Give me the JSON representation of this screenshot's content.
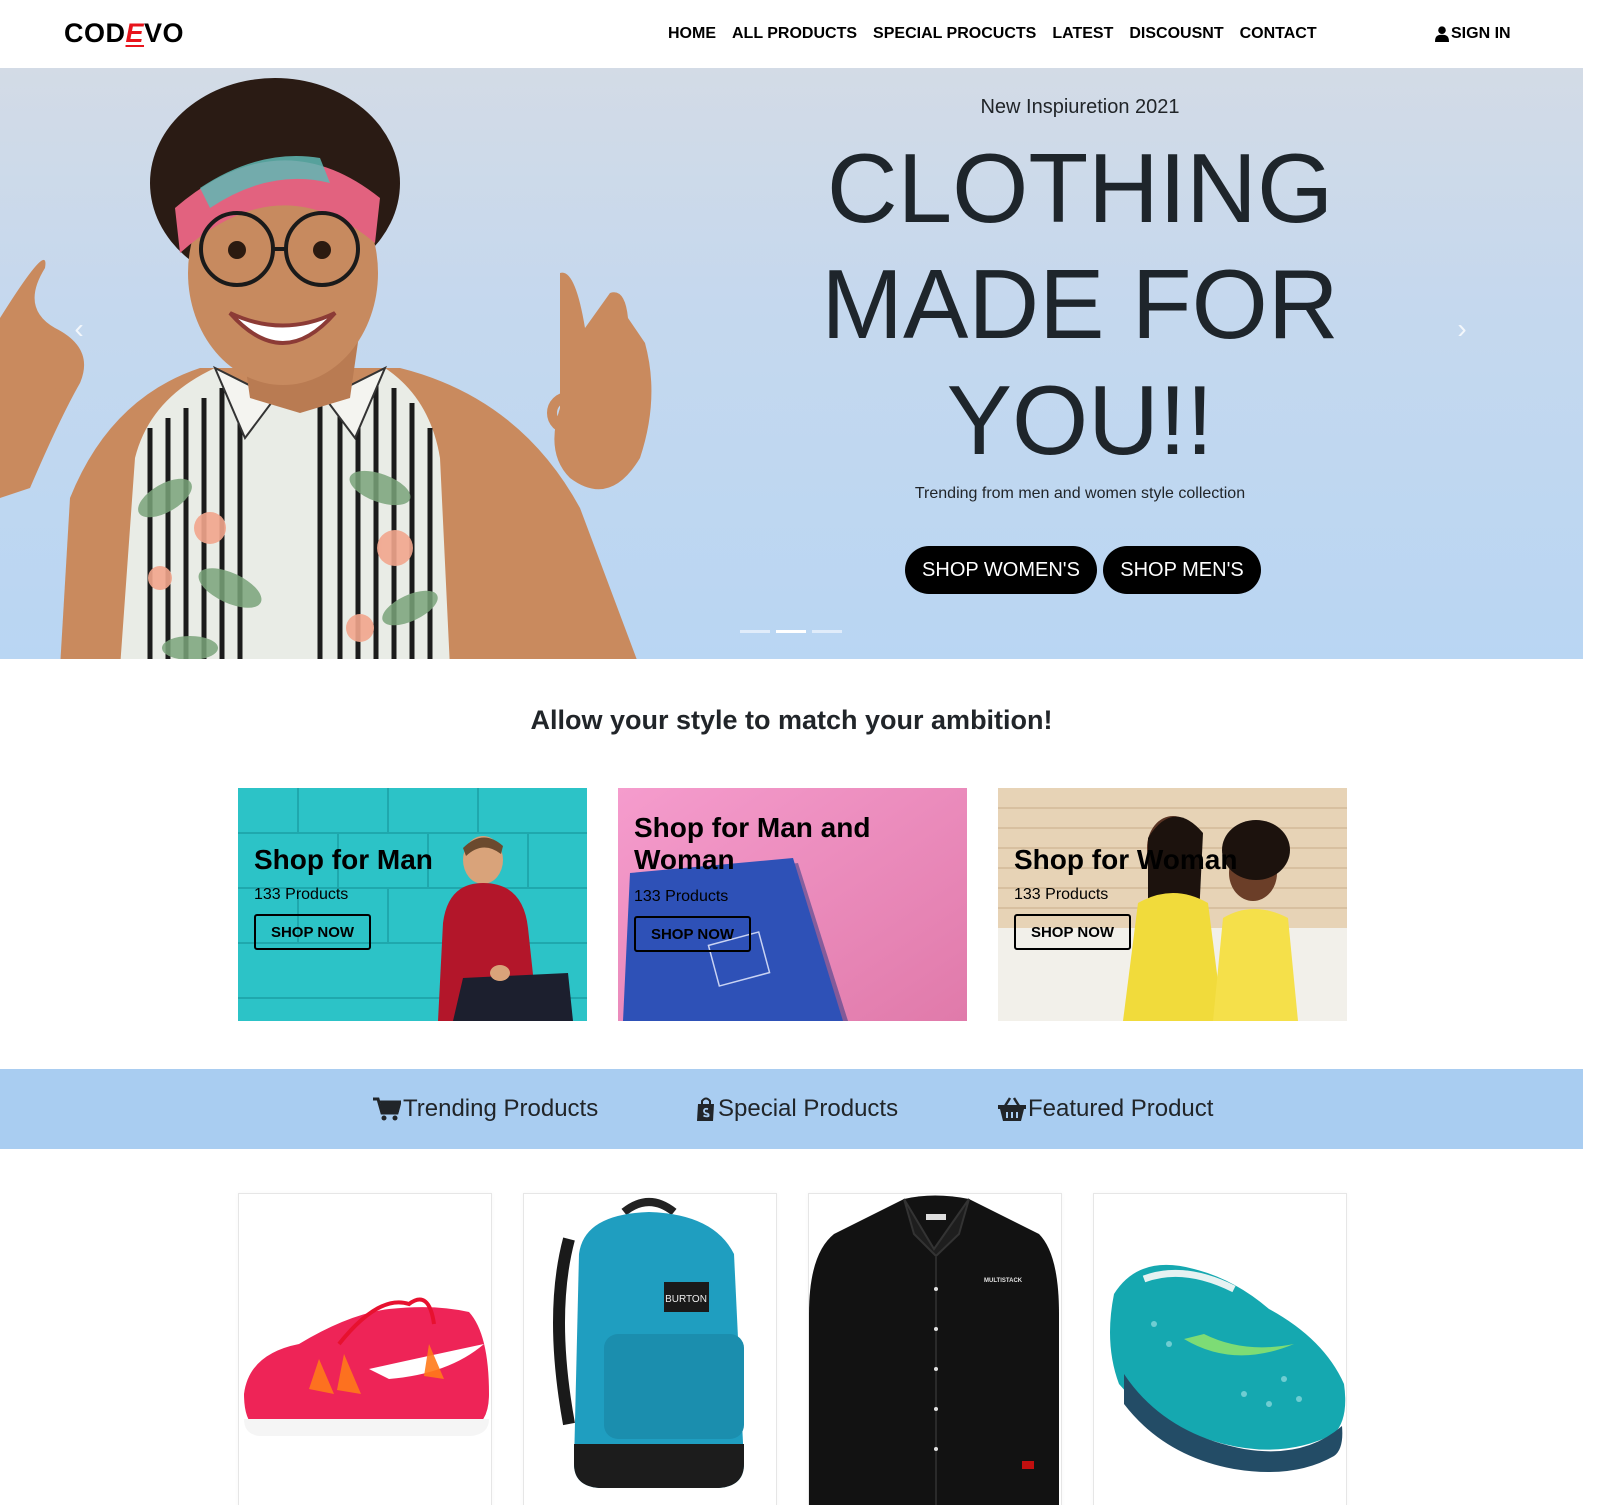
{
  "brand": {
    "prefix": "COD",
    "accent": "E",
    "suffix": "VO",
    "accent_color": "#e8141c"
  },
  "nav": {
    "items": [
      "HOME",
      "ALL PRODUCTS",
      "SPECIAL PROCUCTS",
      "LATEST",
      "DISCOUSNT",
      "CONTACT"
    ],
    "sign_in": "SIGN IN"
  },
  "hero": {
    "kicker": "New Inspiuretion 2021",
    "title": "CLOTHING MADE FOR YOU!!",
    "subtitle": "Trending from men and women style collection",
    "shop_womens": "SHOP WOMEN'S",
    "shop_mens": "SHOP MEN'S",
    "prev_icon": "chevron-left-icon",
    "next_icon": "chevron-right-icon",
    "slide_count": 3,
    "active_slide": 2
  },
  "tagline": "Allow your style to match your ambition!",
  "categories": [
    {
      "title": "Shop for Man",
      "count": "133 Products",
      "button": "SHOP NOW",
      "bg": "#2cc3c7"
    },
    {
      "title": "Shop for Man and Woman",
      "count": "133 Products",
      "button": "SHOP NOW",
      "bg": "#ea7fb6"
    },
    {
      "title": "Shop for Woman",
      "count": "133 Products",
      "button": "SHOP NOW",
      "bg": "#e7d3b6"
    }
  ],
  "tabs": [
    {
      "label": "Trending Products",
      "icon": "cart-icon"
    },
    {
      "label": "Special Products",
      "icon": "shopping-bag-icon"
    },
    {
      "label": "Featured Product",
      "icon": "basket-icon"
    }
  ],
  "products": [
    {
      "name": "red-sneaker",
      "icon": "sneaker-icon"
    },
    {
      "name": "blue-backpack",
      "icon": "backpack-icon",
      "brand_label": "BURTON"
    },
    {
      "name": "black-shirt",
      "icon": "shirt-icon",
      "brand_label": "MULTISTACK"
    },
    {
      "name": "teal-sneaker",
      "icon": "sneaker-icon"
    }
  ],
  "colors": {
    "hero_bg": "#c5d8ee",
    "tabs_bg": "#a9cdf1",
    "button_bg": "#000000"
  }
}
